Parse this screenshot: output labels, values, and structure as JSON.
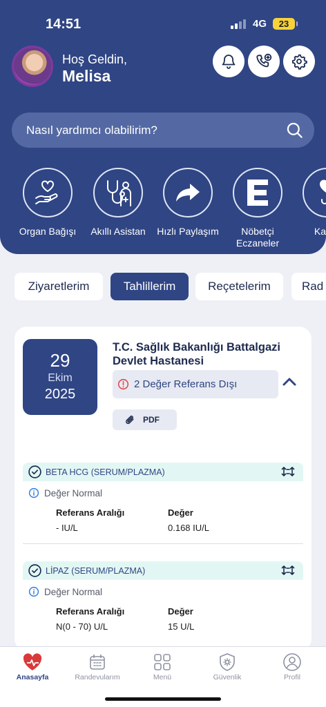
{
  "status_bar": {
    "time": "14:51",
    "network": "4G",
    "battery": "23"
  },
  "header": {
    "greeting": "Hoş Geldin,",
    "user_name": "Melisa"
  },
  "search": {
    "placeholder": "Nasıl yardımcı olabilirim?"
  },
  "quick_actions": [
    {
      "label": "Organ Bağışı",
      "icon": "hand-heart-icon"
    },
    {
      "label": "Akıllı Asistan",
      "icon": "stethoscope-doctor-icon"
    },
    {
      "label": "Hızlı Paylaşım",
      "icon": "share-arrow-icon"
    },
    {
      "label": "Nöbetçi Eczaneler",
      "icon": "pharmacy-e-icon"
    },
    {
      "label": "Kan B",
      "icon": "blood-donation-icon"
    }
  ],
  "tabs": [
    {
      "label": "Ziyaretlerim",
      "active": false
    },
    {
      "label": "Tahlillerim",
      "active": true
    },
    {
      "label": "Reçetelerim",
      "active": false
    },
    {
      "label": "Rad",
      "active": false
    }
  ],
  "lab_card": {
    "date_day": "29",
    "date_month": "Ekim",
    "date_year": "2025",
    "hospital": "T.C. Sağlık Bakanlığı Battalgazi Devlet Hastanesi",
    "out_of_range": "2 Değer Referans Dışı",
    "pdf_label": "PDF",
    "results": [
      {
        "name": "BETA HCG (SERUM/PLAZMA)",
        "status": "Değer Normal",
        "ref_header": "Referans Aralığı",
        "val_header": "Değer",
        "ref_value": "- IU/L",
        "value": "0.168 IU/L"
      },
      {
        "name": "LİPAZ (SERUM/PLAZMA)",
        "status": "Değer Normal",
        "ref_header": "Referans Aralığı",
        "val_header": "Değer",
        "ref_value": "N(0 - 70) U/L",
        "value": "15 U/L"
      }
    ]
  },
  "bottom_nav": [
    {
      "label": "Anasayfa",
      "icon": "home-heart-icon",
      "active": true
    },
    {
      "label": "Randevularım",
      "icon": "calendar-icon",
      "active": false
    },
    {
      "label": "Menü",
      "icon": "grid-menu-icon",
      "active": false
    },
    {
      "label": "Güvenlik",
      "icon": "shield-gear-icon",
      "active": false
    },
    {
      "label": "Profil",
      "icon": "profile-icon",
      "active": false
    }
  ],
  "colors": {
    "primary": "#2f4584",
    "search_bg": "#5469a3",
    "result_bar": "#e2f7f3",
    "alert": "#e04848",
    "check": "#1f8a70"
  }
}
